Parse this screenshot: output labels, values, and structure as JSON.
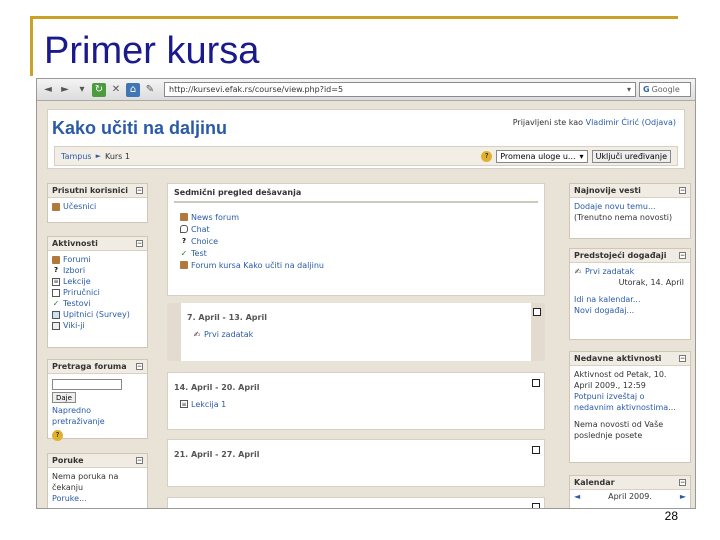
{
  "slide": {
    "title": "Primer kursa",
    "page_number": "28"
  },
  "browser": {
    "url": "http://kursevi.efak.rs/course/view.php?id=5",
    "search_placeholder": "Google"
  },
  "header": {
    "site_title": "Kako učiti na daljinu",
    "login_prefix": "Prijavljeni ste kao",
    "user_name": "Vladimir Ćirić",
    "logout": "(Odjava)"
  },
  "navbar": {
    "crumb_home": "Tampus",
    "crumb_course": "Kurs 1",
    "role_select": "Promena uloge u...",
    "edit_button": "Uključi uređivanje"
  },
  "blocks": {
    "people": {
      "title": "Prisutni korisnici",
      "items": [
        "Učesnici"
      ]
    },
    "activities": {
      "title": "Aktivnosti",
      "items": [
        "Forumi",
        "Izbori",
        "Lekcije",
        "Priručnici",
        "Testovi",
        "Upitnici (Survey)",
        "Viki-ji"
      ]
    },
    "search_forum": {
      "title": "Pretraga foruma",
      "button": "Daje",
      "advanced": "Napredno pretraživanje"
    },
    "messages": {
      "title": "Poruke",
      "line1": "Nema poruka na",
      "line2": "čekanju",
      "link": "Poruke..."
    },
    "latest_news": {
      "title": "Najnovije vesti",
      "add_topic": "Dodaje novu temu...",
      "no_news": "(Trenutno nema novosti)"
    },
    "upcoming": {
      "title": "Predstojeći događaji",
      "event": "Prvi zadatak",
      "event_date": "Utorak, 14. April",
      "goto_calendar": "Idi na kalendar...",
      "new_event": "Novi događaj..."
    },
    "recent": {
      "title": "Nedavne aktivnosti",
      "since": "Aktivnost od Petak, 10. April 2009., 12:59",
      "full_report": "Potpuni izveštaj o nedavnim aktivnostima...",
      "none": "Nema novosti od Vaše poslednje posete"
    },
    "calendar": {
      "title": "Kalendar",
      "month": "April 2009.",
      "prev": "◄",
      "next": "►"
    }
  },
  "center": {
    "summary_title": "Sedmični pregled dešavanja",
    "summary_items": [
      "News forum",
      "Chat",
      "Choice",
      "Test",
      "Forum kursa Kako učiti na daljinu"
    ],
    "weeks": [
      {
        "title": "7. April - 13. April",
        "items": [
          "Prvi zadatak"
        ]
      },
      {
        "title": "14. April - 20. April",
        "items": [
          "Lekcija 1"
        ]
      },
      {
        "title": "21. April - 27. April",
        "items": []
      }
    ]
  }
}
